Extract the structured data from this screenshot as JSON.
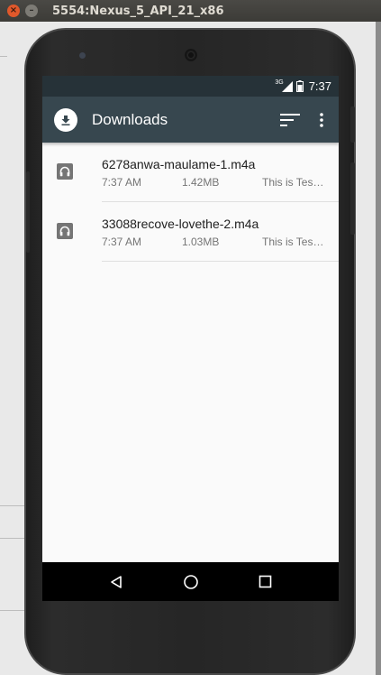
{
  "window": {
    "title": "5554:Nexus_5_API_21_x86",
    "close_glyph": "×",
    "minimize_glyph": "–"
  },
  "status_bar": {
    "network": "3G",
    "time": "7:37"
  },
  "app_bar": {
    "title": "Downloads"
  },
  "downloads": [
    {
      "name": "6278anwa-maulame-1.m4a",
      "time": "7:37 AM",
      "size": "1.42MB",
      "description": "This is Tes…"
    },
    {
      "name": "33088recove-lovethe-2.m4a",
      "time": "7:37 AM",
      "size": "1.03MB",
      "description": "This is Tes…"
    }
  ],
  "nav": {
    "back": "back-icon",
    "home": "home-icon",
    "recents": "recents-icon"
  },
  "colors": {
    "status_bar": "#263238",
    "app_bar": "#37474f",
    "list_bg": "#fafafa",
    "nav_bar": "#000000"
  }
}
